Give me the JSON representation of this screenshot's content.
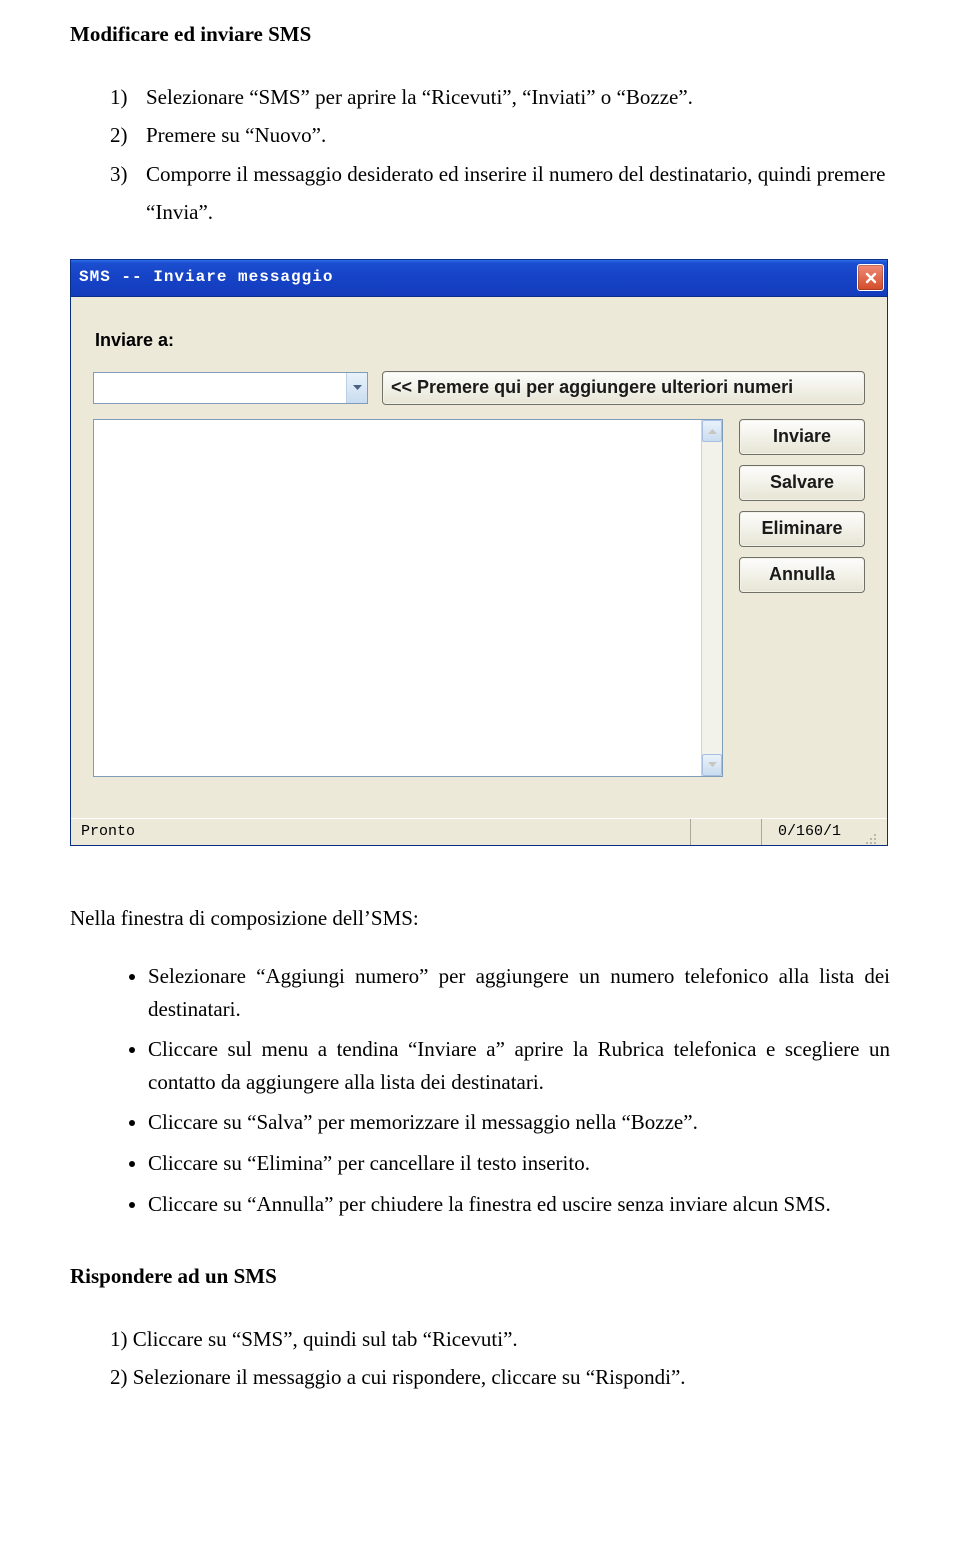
{
  "doc": {
    "title": "Modificare ed inviare SMS",
    "steps": [
      "Selezionare “SMS” per aprire la “Ricevuti”, “Inviati” o “Bozze”.",
      "Premere su “Nuovo”.",
      "Comporre il messaggio desiderato ed inserire il numero del destinatario, quindi premere"
    ],
    "step3_tail": "“Invia”.",
    "after_window": "Nella finestra di composizione dell’SMS:",
    "bullets": [
      "Selezionare “Aggiungi numero” per aggiungere un numero telefonico alla lista dei destinatari.",
      "Cliccare sul menu a tendina “Inviare a” aprire la Rubrica telefonica e scegliere un contatto da aggiungere alla lista dei destinatari.",
      "Cliccare su “Salva” per memorizzare il messaggio nella “Bozze”.",
      "Cliccare su “Elimina” per cancellare il testo inserito.",
      "Cliccare su “Annulla” per chiudere la finestra ed uscire senza inviare alcun SMS."
    ],
    "subtitle": "Rispondere ad un SMS",
    "final1": "1) Cliccare su “SMS”, quindi sul tab “Ricevuti”.",
    "final2": "2) Selezionare il messaggio a cui rispondere, cliccare su “Rispondi”."
  },
  "window": {
    "title": "SMS -- Inviare messaggio",
    "send_to_label": "Inviare a:",
    "add_numbers": "<<  Premere qui per aggiungere ulteriori numeri",
    "buttons": {
      "send": "Inviare",
      "save": "Salvare",
      "delete": "Eliminare",
      "cancel": "Annulla"
    },
    "status_left": "Pronto",
    "status_right": "0/160/1"
  }
}
